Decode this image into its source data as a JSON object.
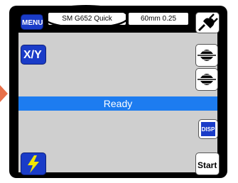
{
  "menu": {
    "label": "MENU"
  },
  "program": {
    "label": "SM G652 Quick"
  },
  "cleave_length": {
    "label": "60mm 0.25"
  },
  "xy_view": {
    "label": "X/Y"
  },
  "status": {
    "label": "Ready"
  },
  "display_toggle": {
    "label": "DISP"
  },
  "start": {
    "label": "Start"
  },
  "icons": {
    "power": "plug-icon",
    "fiber_left": "fiber-holder-icon",
    "fiber_right": "fiber-holder-icon",
    "arc": "lightning-icon"
  },
  "colors": {
    "status_bar": "#1d7cf0",
    "button_blue": "#1a3cc8",
    "screen_bg": "#cfcfcf",
    "frame": "#000000",
    "arc_yellow": "#f2e600",
    "side_tab": "#e8704a"
  }
}
